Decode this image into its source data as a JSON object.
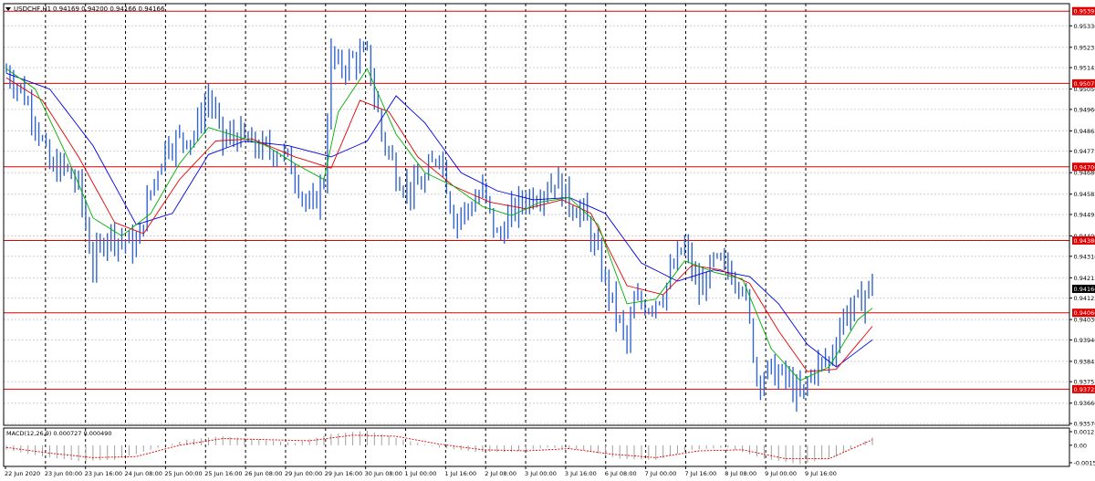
{
  "header": {
    "symbol_label": "USDCHF,H1",
    "ohlc": "0.94169 0.94200 0.94166 0.94166"
  },
  "colors": {
    "candle": "#3366cc",
    "ma_fast": "#00b000",
    "ma_mid": "#e00000",
    "ma_slow": "#0000e0",
    "level": "#e00000",
    "macd_hist": "#a0a0a0",
    "macd_signal": "#e00000",
    "grid_v": "#000000",
    "grid_h": "#cfcfcf",
    "axis": "#000000"
  },
  "chart_data": [
    {
      "type": "line",
      "title": "USDCHF,H1",
      "y_ticks": [
        "0.95330",
        "0.95235",
        "0.95145",
        "0.95050",
        "0.94960",
        "0.94865",
        "0.94775",
        "0.94680",
        "0.94585",
        "0.94495",
        "0.94400",
        "0.94310",
        "0.94215",
        "0.94125",
        "0.94030",
        "0.93940",
        "0.93845",
        "0.93755",
        "0.93660",
        "0.93570"
      ],
      "ylim": [
        0.9357,
        0.9542
      ],
      "x_ticks": [
        "22 Jun 2020",
        "23 Jun 00:00",
        "23 Jun 16:00",
        "24 Jun 08:00",
        "25 Jun 00:00",
        "25 Jun 16:00",
        "26 Jun 08:00",
        "29 Jun 00:00",
        "29 Jun 16:00",
        "30 Jun 08:00",
        "1 Jul 00:00",
        "1 Jul 16:00",
        "2 Jul 08:00",
        "3 Jul 00:00",
        "3 Jul 16:00",
        "6 Jul 08:00",
        "7 Jul 00:00",
        "7 Jul 16:00",
        "8 Jul 08:00",
        "9 Jul 00:00",
        "9 Jul 16:00"
      ],
      "levels": [
        {
          "value": 0.95395,
          "label": "0.95395"
        },
        {
          "value": 0.95075,
          "label": "0.95075"
        },
        {
          "value": 0.94706,
          "label": "0.94706"
        },
        {
          "value": 0.9438,
          "label": "0.94380"
        },
        {
          "value": 0.9406,
          "label": "0.94060"
        },
        {
          "value": 0.93722,
          "label": "0.93722"
        }
      ],
      "current_price": {
        "value": 0.94166,
        "label": "0.94166"
      },
      "close_path": [
        [
          0,
          0.9513
        ],
        [
          4,
          0.9505
        ],
        [
          8,
          0.9492
        ],
        [
          12,
          0.947
        ],
        [
          16,
          0.947
        ],
        [
          20,
          0.9462
        ],
        [
          24,
          0.9427
        ],
        [
          28,
          0.9442
        ],
        [
          32,
          0.9438
        ],
        [
          36,
          0.9435
        ],
        [
          40,
          0.946
        ],
        [
          44,
          0.948
        ],
        [
          48,
          0.9483
        ],
        [
          52,
          0.9485
        ],
        [
          56,
          0.9502
        ],
        [
          60,
          0.9482
        ],
        [
          64,
          0.9485
        ],
        [
          68,
          0.948
        ],
        [
          72,
          0.9478
        ],
        [
          76,
          0.9478
        ],
        [
          80,
          0.9468
        ],
        [
          84,
          0.945
        ],
        [
          88,
          0.9465
        ],
        [
          90,
          0.952
        ],
        [
          92,
          0.9514
        ],
        [
          96,
          0.9518
        ],
        [
          100,
          0.952
        ],
        [
          104,
          0.9485
        ],
        [
          108,
          0.9468
        ],
        [
          112,
          0.946
        ],
        [
          116,
          0.9464
        ],
        [
          120,
          0.9479
        ],
        [
          124,
          0.9448
        ],
        [
          128,
          0.9452
        ],
        [
          132,
          0.946
        ],
        [
          136,
          0.9439
        ],
        [
          140,
          0.945
        ],
        [
          144,
          0.9457
        ],
        [
          148,
          0.946
        ],
        [
          152,
          0.9465
        ],
        [
          156,
          0.9455
        ],
        [
          160,
          0.945
        ],
        [
          164,
          0.943
        ],
        [
          168,
          0.941
        ],
        [
          172,
          0.9392
        ],
        [
          174,
          0.941
        ],
        [
          178,
          0.941
        ],
        [
          182,
          0.9415
        ],
        [
          186,
          0.943
        ],
        [
          188,
          0.9435
        ],
        [
          192,
          0.9415
        ],
        [
          196,
          0.9428
        ],
        [
          200,
          0.9425
        ],
        [
          204,
          0.942
        ],
        [
          206,
          0.94
        ],
        [
          208,
          0.9378
        ],
        [
          212,
          0.938
        ],
        [
          216,
          0.9377
        ],
        [
          220,
          0.9368
        ],
        [
          224,
          0.9382
        ],
        [
          228,
          0.9385
        ],
        [
          232,
          0.9405
        ],
        [
          236,
          0.941
        ],
        [
          240,
          0.9419
        ]
      ],
      "ma_fast": [
        [
          0,
          0.9514
        ],
        [
          8,
          0.9505
        ],
        [
          16,
          0.9478
        ],
        [
          24,
          0.9448
        ],
        [
          32,
          0.944
        ],
        [
          40,
          0.945
        ],
        [
          48,
          0.9472
        ],
        [
          56,
          0.9488
        ],
        [
          64,
          0.9484
        ],
        [
          72,
          0.948
        ],
        [
          80,
          0.9472
        ],
        [
          88,
          0.9465
        ],
        [
          92,
          0.9495
        ],
        [
          100,
          0.9514
        ],
        [
          108,
          0.9485
        ],
        [
          116,
          0.9468
        ],
        [
          124,
          0.9462
        ],
        [
          132,
          0.9453
        ],
        [
          140,
          0.9449
        ],
        [
          148,
          0.9455
        ],
        [
          156,
          0.9457
        ],
        [
          164,
          0.9445
        ],
        [
          172,
          0.941
        ],
        [
          180,
          0.9412
        ],
        [
          188,
          0.9429
        ],
        [
          196,
          0.9424
        ],
        [
          204,
          0.9421
        ],
        [
          212,
          0.939
        ],
        [
          220,
          0.9376
        ],
        [
          228,
          0.9382
        ],
        [
          236,
          0.9403
        ],
        [
          240,
          0.9408
        ]
      ],
      "ma_mid": [
        [
          0,
          0.951
        ],
        [
          10,
          0.95
        ],
        [
          20,
          0.9475
        ],
        [
          30,
          0.9446
        ],
        [
          38,
          0.9441
        ],
        [
          48,
          0.9465
        ],
        [
          58,
          0.9482
        ],
        [
          68,
          0.9483
        ],
        [
          80,
          0.9475
        ],
        [
          90,
          0.947
        ],
        [
          98,
          0.95
        ],
        [
          106,
          0.9495
        ],
        [
          114,
          0.9475
        ],
        [
          124,
          0.9462
        ],
        [
          134,
          0.9455
        ],
        [
          144,
          0.9452
        ],
        [
          154,
          0.9456
        ],
        [
          162,
          0.945
        ],
        [
          172,
          0.9418
        ],
        [
          182,
          0.9414
        ],
        [
          190,
          0.9427
        ],
        [
          198,
          0.9425
        ],
        [
          206,
          0.9419
        ],
        [
          214,
          0.9398
        ],
        [
          222,
          0.938
        ],
        [
          230,
          0.9381
        ],
        [
          240,
          0.94
        ]
      ],
      "ma_slow": [
        [
          0,
          0.9512
        ],
        [
          12,
          0.9505
        ],
        [
          24,
          0.948
        ],
        [
          36,
          0.9445
        ],
        [
          46,
          0.945
        ],
        [
          56,
          0.9476
        ],
        [
          66,
          0.9482
        ],
        [
          78,
          0.948
        ],
        [
          90,
          0.9475
        ],
        [
          100,
          0.9482
        ],
        [
          108,
          0.9502
        ],
        [
          116,
          0.949
        ],
        [
          126,
          0.9468
        ],
        [
          136,
          0.946
        ],
        [
          146,
          0.9456
        ],
        [
          156,
          0.9457
        ],
        [
          166,
          0.945
        ],
        [
          176,
          0.9428
        ],
        [
          186,
          0.942
        ],
        [
          196,
          0.9425
        ],
        [
          206,
          0.9422
        ],
        [
          214,
          0.941
        ],
        [
          222,
          0.9392
        ],
        [
          230,
          0.9382
        ],
        [
          240,
          0.9394
        ]
      ]
    },
    {
      "type": "bar",
      "title": "MACD(12,26,9) 0.000727 0.000490",
      "y_ticks": [
        "0.00121",
        "0.00",
        "-0.00155"
      ],
      "ylim": [
        -0.0018,
        0.00145
      ],
      "histogram": [
        [
          0,
          -0.0004
        ],
        [
          10,
          -0.001
        ],
        [
          20,
          -0.0014
        ],
        [
          30,
          -0.0013
        ],
        [
          40,
          -0.0004
        ],
        [
          50,
          0.0005
        ],
        [
          60,
          0.0008
        ],
        [
          70,
          0.0005
        ],
        [
          80,
          0.0002
        ],
        [
          90,
          0.001
        ],
        [
          100,
          0.0013
        ],
        [
          110,
          0.0005
        ],
        [
          120,
          -0.0002
        ],
        [
          130,
          -0.0006
        ],
        [
          140,
          -0.0006
        ],
        [
          150,
          -0.0002
        ],
        [
          160,
          -0.0004
        ],
        [
          170,
          -0.0012
        ],
        [
          180,
          -0.0013
        ],
        [
          190,
          -0.0004
        ],
        [
          200,
          -0.0002
        ],
        [
          210,
          -0.0012
        ],
        [
          220,
          -0.0017
        ],
        [
          230,
          -0.001
        ],
        [
          240,
          0.0007
        ]
      ],
      "signal": [
        [
          0,
          -0.0002
        ],
        [
          12,
          -0.0007
        ],
        [
          24,
          -0.0011
        ],
        [
          36,
          -0.001
        ],
        [
          48,
          0.0
        ],
        [
          60,
          0.0006
        ],
        [
          72,
          0.0005
        ],
        [
          84,
          0.0004
        ],
        [
          96,
          0.0009
        ],
        [
          108,
          0.0008
        ],
        [
          120,
          0.0001
        ],
        [
          132,
          -0.0004
        ],
        [
          144,
          -0.0005
        ],
        [
          156,
          -0.0003
        ],
        [
          168,
          -0.0008
        ],
        [
          180,
          -0.0011
        ],
        [
          192,
          -0.0005
        ],
        [
          204,
          -0.0004
        ],
        [
          216,
          -0.0012
        ],
        [
          228,
          -0.0012
        ],
        [
          240,
          0.0005
        ]
      ]
    }
  ]
}
